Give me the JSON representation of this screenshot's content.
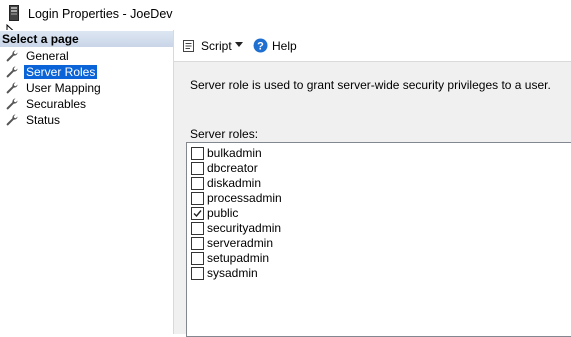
{
  "window": {
    "title": "Login Properties - JoeDev"
  },
  "left_pane": {
    "header": "Select a page",
    "items": [
      {
        "label": "General",
        "selected": false
      },
      {
        "label": "Server Roles",
        "selected": true
      },
      {
        "label": "User Mapping",
        "selected": false
      },
      {
        "label": "Securables",
        "selected": false
      },
      {
        "label": "Status",
        "selected": false
      }
    ]
  },
  "toolbar": {
    "script_label": "Script",
    "help_label": "Help"
  },
  "main": {
    "description": "Server role is used to grant server-wide security privileges to a user.",
    "roles_label": "Server roles:",
    "roles": [
      {
        "name": "bulkadmin",
        "checked": false
      },
      {
        "name": "dbcreator",
        "checked": false
      },
      {
        "name": "diskadmin",
        "checked": false
      },
      {
        "name": "processadmin",
        "checked": false
      },
      {
        "name": "public",
        "checked": true
      },
      {
        "name": "securityadmin",
        "checked": false
      },
      {
        "name": "serveradmin",
        "checked": false
      },
      {
        "name": "setupadmin",
        "checked": false
      },
      {
        "name": "sysadmin",
        "checked": false
      }
    ]
  },
  "colors": {
    "selection": "#0a64d8",
    "panel_bg": "#f0f0f0",
    "header_bg": "#c9d6e8"
  }
}
